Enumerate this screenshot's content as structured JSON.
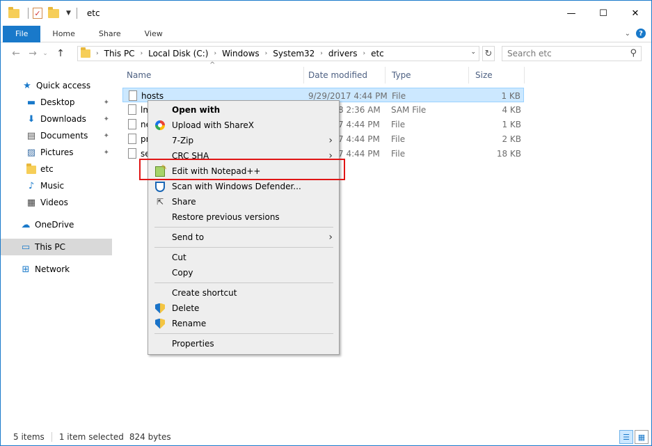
{
  "window": {
    "title": "etc",
    "controls": {
      "minimize": "—",
      "maximize": "☐",
      "close": "✕"
    }
  },
  "ribbon": {
    "tabs": [
      "File",
      "Home",
      "Share",
      "View"
    ]
  },
  "navigation": {
    "back": "←",
    "forward": "→",
    "recent": "⌄",
    "up": "↑",
    "breadcrumb": [
      "This PC",
      "Local Disk (C:)",
      "Windows",
      "System32",
      "drivers",
      "etc"
    ],
    "refresh": "↻",
    "search_placeholder": "Search etc"
  },
  "sidebar": {
    "items": [
      {
        "label": "Quick access",
        "icon": "star-icon",
        "glyph": "★",
        "pinned": false
      },
      {
        "label": "Desktop",
        "icon": "desktop-icon",
        "glyph": "▬",
        "pinned": true
      },
      {
        "label": "Downloads",
        "icon": "download-icon",
        "glyph": "⬇",
        "pinned": true
      },
      {
        "label": "Documents",
        "icon": "documents-icon",
        "glyph": "▤",
        "pinned": true
      },
      {
        "label": "Pictures",
        "icon": "pictures-icon",
        "glyph": "▨",
        "pinned": true
      },
      {
        "label": "etc",
        "icon": "folder-icon",
        "glyph": "",
        "pinned": false
      },
      {
        "label": "Music",
        "icon": "music-icon",
        "glyph": "♪",
        "pinned": false
      },
      {
        "label": "Videos",
        "icon": "videos-icon",
        "glyph": "▦",
        "pinned": false
      },
      {
        "label": "OneDrive",
        "icon": "onedrive-icon",
        "glyph": "☁",
        "pinned": false
      },
      {
        "label": "This PC",
        "icon": "computer-icon",
        "glyph": "▭",
        "pinned": false
      },
      {
        "label": "Network",
        "icon": "network-icon",
        "glyph": "⊞",
        "pinned": false
      }
    ],
    "pin_glyph": "📌"
  },
  "file_list": {
    "columns": [
      "Name",
      "Date modified",
      "Type",
      "Size"
    ],
    "sort_indicator": "^",
    "rows": [
      {
        "name": "hosts",
        "date": "9/29/2017 4:44 PM",
        "type": "File",
        "size": "1 KB",
        "selected": true
      },
      {
        "name": "lm",
        "date": "8 2:36 AM",
        "type": "SAM File",
        "size": "4 KB",
        "selected": false
      },
      {
        "name": "ne",
        "date": "7 4:44 PM",
        "type": "File",
        "size": "1 KB",
        "selected": false
      },
      {
        "name": "pr",
        "date": "7 4:44 PM",
        "type": "File",
        "size": "2 KB",
        "selected": false
      },
      {
        "name": "se",
        "date": "7 4:44 PM",
        "type": "File",
        "size": "18 KB",
        "selected": false
      }
    ]
  },
  "context_menu": {
    "items": [
      {
        "label": "Open with",
        "bold": true,
        "icon": "",
        "submenu": false
      },
      {
        "label": "Upload with ShareX",
        "icon": "sharex-icon",
        "submenu": false
      },
      {
        "label": "7-Zip",
        "icon": "",
        "submenu": true
      },
      {
        "label": "CRC SHA",
        "icon": "",
        "submenu": true
      },
      {
        "label": "Edit with Notepad++",
        "icon": "notepad-plus-plus-icon",
        "submenu": false,
        "highlighted": true
      },
      {
        "label": "Scan with Windows Defender...",
        "icon": "windows-defender-icon",
        "submenu": false
      },
      {
        "label": "Share",
        "icon": "share-icon",
        "submenu": false
      },
      {
        "label": "Restore previous versions",
        "icon": "",
        "submenu": false
      },
      {
        "label": "Send to",
        "icon": "",
        "submenu": true
      },
      {
        "label": "Cut",
        "icon": "",
        "submenu": false
      },
      {
        "label": "Copy",
        "icon": "",
        "submenu": false
      },
      {
        "label": "Create shortcut",
        "icon": "",
        "submenu": false
      },
      {
        "label": "Delete",
        "icon": "uac-shield-icon",
        "submenu": false
      },
      {
        "label": "Rename",
        "icon": "uac-shield-icon",
        "submenu": false
      },
      {
        "label": "Properties",
        "icon": "",
        "submenu": false
      }
    ],
    "submenu_arrow": "›",
    "highlight_color": "#e01515"
  },
  "status_bar": {
    "item_count": "5 items",
    "selection": "1 item selected",
    "size": "824 bytes"
  },
  "colors": {
    "accent": "#1979ca",
    "selection": "#cce8ff",
    "menu_bg": "#eeeeee"
  }
}
